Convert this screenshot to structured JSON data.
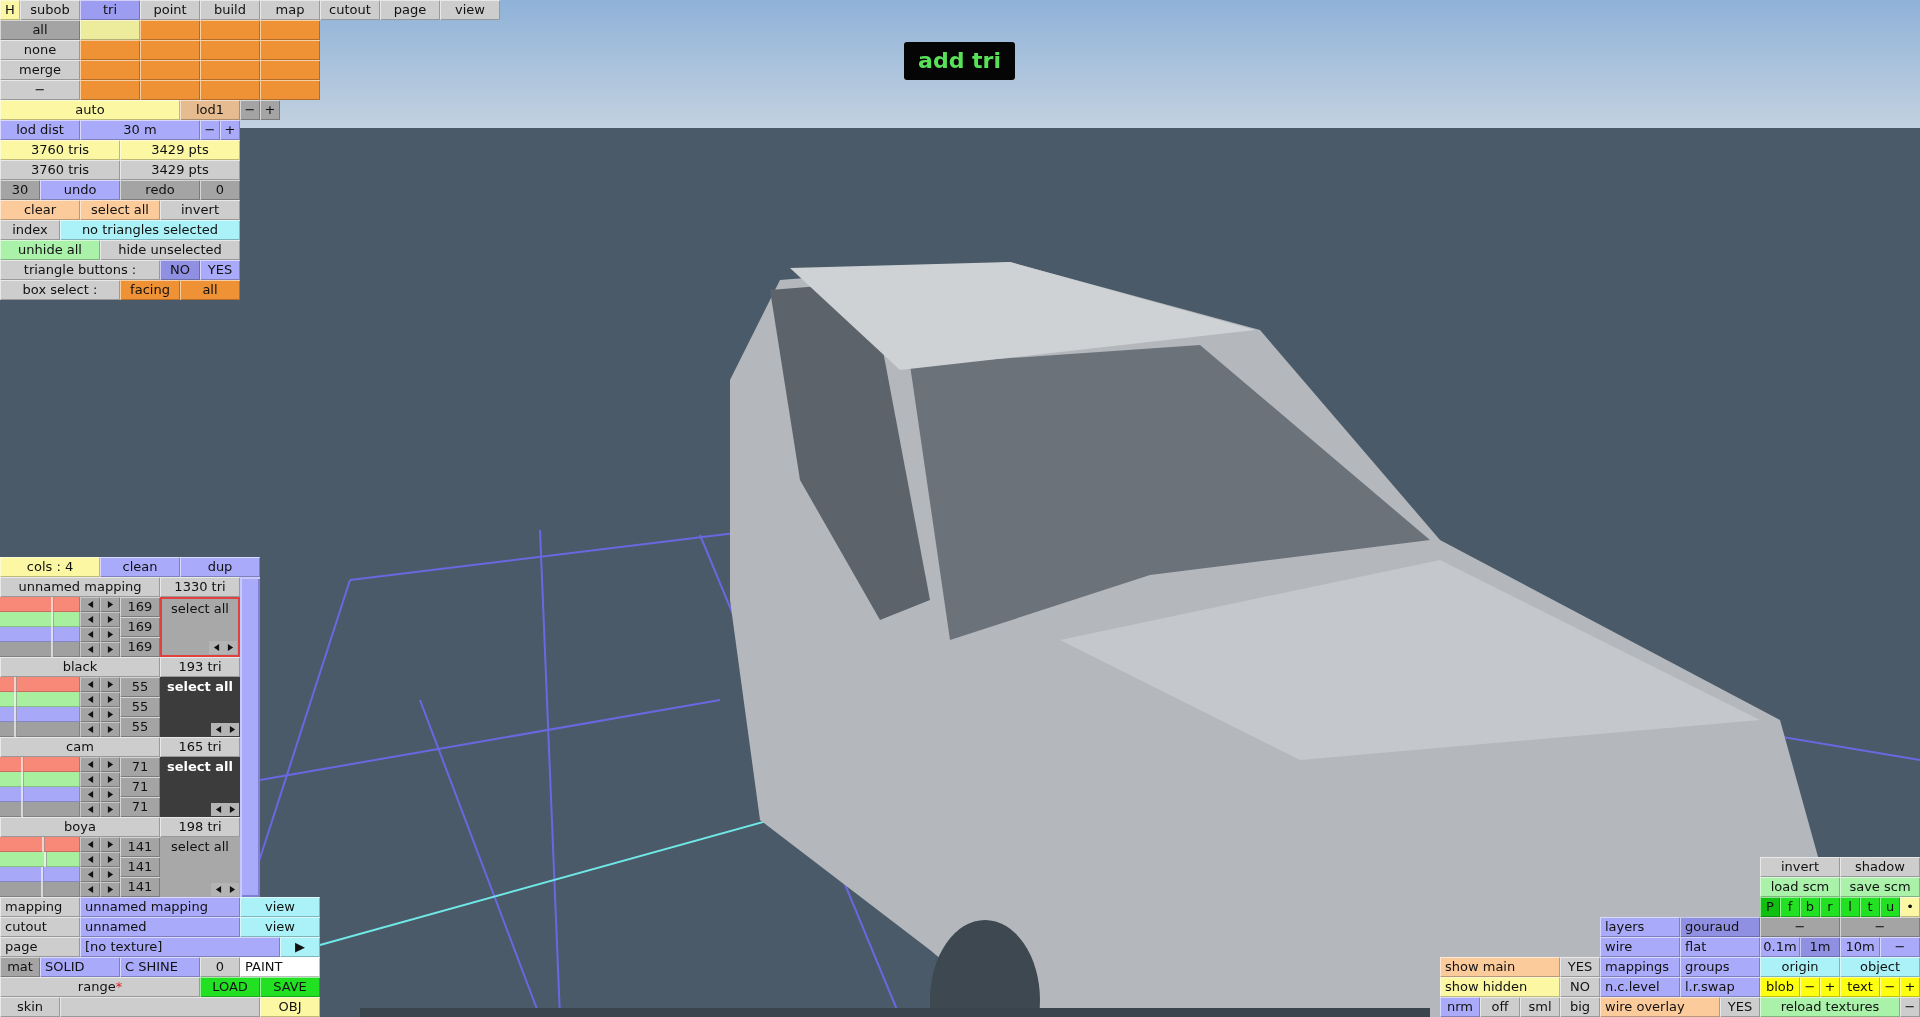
{
  "menu": {
    "help": {
      "label": "H"
    },
    "tabs": [
      {
        "label": "subob",
        "selected": false
      },
      {
        "label": "tri",
        "selected": true
      },
      {
        "label": "point",
        "selected": false
      },
      {
        "label": "build",
        "selected": false
      },
      {
        "label": "map",
        "selected": false
      },
      {
        "label": "cutout",
        "selected": false
      },
      {
        "label": "page",
        "selected": false
      },
      {
        "label": "view",
        "selected": false
      }
    ]
  },
  "status_message": "add tri",
  "top_panel": {
    "rows": [
      {
        "buttons": [
          {
            "text": "all",
            "color": "#a4a4a4",
            "kind": "button"
          },
          {
            "color": "#ecec9c",
            "kind": "swatch"
          },
          {
            "color": "#ef9236",
            "kind": "swatch"
          },
          {
            "color": "#ef9236",
            "kind": "swatch"
          },
          {
            "color": "#ef9236",
            "kind": "swatch"
          }
        ]
      },
      {
        "buttons": [
          {
            "text": "none",
            "color": "#cdcdcd",
            "kind": "button"
          },
          {
            "color": "#ef9236",
            "kind": "swatch"
          },
          {
            "color": "#ef9236",
            "kind": "swatch"
          },
          {
            "color": "#ef9236",
            "kind": "swatch"
          },
          {
            "color": "#ef9236",
            "kind": "swatch"
          }
        ]
      },
      {
        "buttons": [
          {
            "text": "merge",
            "color": "#cdcdcd",
            "kind": "button"
          },
          {
            "color": "#ef9236",
            "kind": "swatch"
          },
          {
            "color": "#ef9236",
            "kind": "swatch"
          },
          {
            "color": "#ef9236",
            "kind": "swatch"
          },
          {
            "color": "#ef9236",
            "kind": "swatch"
          }
        ]
      },
      {
        "buttons": [
          {
            "text": "−",
            "color": "#cdcdcd",
            "kind": "button"
          },
          {
            "color": "#ef9236",
            "kind": "swatch"
          },
          {
            "color": "#ef9236",
            "kind": "swatch"
          },
          {
            "color": "#ef9236",
            "kind": "swatch"
          },
          {
            "color": "#ef9236",
            "kind": "swatch"
          }
        ]
      },
      {
        "buttons": [
          {
            "text": "auto",
            "color": "#fbf7a2",
            "kind": "button"
          },
          {
            "text": "lod1",
            "color": "#e6bb8f",
            "kind": "button"
          },
          {
            "text": "−",
            "color": "#a4a4a4",
            "kind": "button"
          },
          {
            "text": "+",
            "color": "#a4a4a4",
            "kind": "button"
          }
        ]
      },
      {
        "buttons": [
          {
            "text": "lod dist",
            "color": "#aaaafa",
            "kind": "button"
          },
          {
            "text": "30 m",
            "color": "#aaaafa",
            "kind": "button"
          },
          {
            "text": "−",
            "color": "#aaaafa",
            "kind": "button"
          },
          {
            "text": "+",
            "color": "#aaaafa",
            "kind": "button"
          }
        ]
      },
      {
        "buttons": [
          {
            "text": "3760 tris",
            "color": "#fbf7a2",
            "kind": "button"
          },
          {
            "text": "3429 pts",
            "color": "#fbf7a2",
            "kind": "button"
          }
        ]
      },
      {
        "buttons": [
          {
            "text": "3760 tris",
            "color": "#cdcdcd",
            "kind": "button"
          },
          {
            "text": "3429 pts",
            "color": "#cdcdcd",
            "kind": "button"
          }
        ]
      },
      {
        "buttons": [
          {
            "text": "30",
            "color": "#a4a4a4",
            "kind": "button"
          },
          {
            "text": "undo",
            "color": "#aaaafa",
            "kind": "button"
          },
          {
            "text": "redo",
            "color": "#a4a4a4",
            "kind": "button"
          },
          {
            "text": "0",
            "color": "#a4a4a4",
            "kind": "button"
          }
        ]
      },
      {
        "buttons": [
          {
            "text": "clear",
            "color": "#fbcb9b",
            "kind": "button"
          },
          {
            "text": "select all",
            "color": "#fbcb9b",
            "kind": "button"
          },
          {
            "text": "invert",
            "color": "#cdcdcd",
            "kind": "button"
          }
        ]
      },
      {
        "buttons": [
          {
            "text": "index",
            "color": "#cdcdcd",
            "kind": "button"
          },
          {
            "text": "no triangles selected",
            "color": "#aaf2f8",
            "kind": "button"
          }
        ]
      },
      {
        "buttons": [
          {
            "text": "unhide all",
            "color": "#aaf2aa",
            "kind": "button"
          },
          {
            "text": "hide unselected",
            "color": "#cdcdcd",
            "kind": "button"
          }
        ]
      },
      {
        "buttons": [
          {
            "text": "triangle buttons :",
            "color": "#cdcdcd",
            "kind": "button"
          },
          {
            "text": "NO",
            "color": "#9090e2",
            "kind": "button"
          },
          {
            "text": "YES",
            "color": "#aaaafa",
            "kind": "button"
          }
        ]
      },
      {
        "buttons": [
          {
            "text": "box select :",
            "color": "#cdcdcd",
            "kind": "button"
          },
          {
            "text": "facing",
            "color": "#ef9236",
            "kind": "button"
          },
          {
            "text": "all",
            "color": "#ef9236",
            "kind": "button"
          }
        ]
      }
    ]
  },
  "mappings_panel": {
    "header": {
      "buttons": [
        {
          "text": "cols : 4",
          "color": "#fbf7a2",
          "kind": "button"
        },
        {
          "text": "clean",
          "color": "#aaaafa",
          "kind": "button"
        },
        {
          "text": "dup",
          "color": "#aaaafa",
          "kind": "button"
        }
      ]
    },
    "mappings": [
      {
        "name": "unnamed mapping",
        "count": "1330 tri",
        "values": [
          "169",
          "169",
          "169"
        ],
        "select_button": {
          "label": "select all",
          "color": "#a8a8a8"
        },
        "selected": true,
        "sliders": [
          {
            "color": "#f88878",
            "level": 0.65
          },
          {
            "color": "#a8f0a0",
            "level": 0.65
          },
          {
            "color": "#a8a8f8",
            "level": 0.65
          },
          {
            "color": "#a0a0a0",
            "level": 0.65
          }
        ]
      },
      {
        "name": "black",
        "count": "193 tri",
        "values": [
          "55",
          "55",
          "55"
        ],
        "select_button": {
          "label": "select all",
          "color": "#3c3c3c"
        },
        "selected": false,
        "sliders": [
          {
            "color": "#f88878",
            "level": 0.19
          },
          {
            "color": "#a8f0a0",
            "level": 0.19
          },
          {
            "color": "#a8a8f8",
            "level": 0.19
          },
          {
            "color": "#a0a0a0",
            "level": 0.19
          }
        ]
      },
      {
        "name": "cam",
        "count": "165 tri",
        "values": [
          "71",
          "71",
          "71"
        ],
        "select_button": {
          "label": "select all",
          "color": "#3c3c3c"
        },
        "selected": false,
        "sliders": [
          {
            "color": "#f88878",
            "level": 0.27
          },
          {
            "color": "#a8f0a0",
            "level": 0.27
          },
          {
            "color": "#a8a8f8",
            "level": 0.27
          },
          {
            "color": "#a0a0a0",
            "level": 0.27
          }
        ]
      },
      {
        "name": "boya",
        "count": "198 tri",
        "values": [
          "141",
          "141",
          "141"
        ],
        "select_button": {
          "label": "select all",
          "color": "#a8a8a8"
        },
        "selected": false,
        "sliders": [
          {
            "color": "#f88878",
            "level": 0.54
          },
          {
            "color": "#a8f0a0",
            "level": 0.56
          },
          {
            "color": "#a8a8f8",
            "level": 0.52
          },
          {
            "color": "#a0a0a0",
            "level": 0.53
          }
        ]
      }
    ],
    "rows": [
      {
        "buttons": [
          {
            "text": "mapping",
            "color": "#cdcdcd",
            "kind": "label"
          },
          {
            "text": "unnamed mapping",
            "color": "#aaaafa",
            "kind": "label"
          },
          {
            "text": "view",
            "color": "#aaf2f8",
            "kind": "button"
          }
        ]
      },
      {
        "buttons": [
          {
            "text": "cutout",
            "color": "#cdcdcd",
            "kind": "label"
          },
          {
            "text": "unnamed",
            "color": "#aaaafa",
            "kind": "label"
          },
          {
            "text": "view",
            "color": "#aaf2f8",
            "kind": "button"
          }
        ]
      },
      {
        "buttons": [
          {
            "text": "page",
            "color": "#cdcdcd",
            "kind": "label"
          },
          {
            "text": "[no texture]",
            "color": "#aaaafa",
            "kind": "label"
          },
          {
            "text": "▶",
            "color": "#aaf2f8",
            "kind": "button"
          }
        ]
      },
      {
        "buttons": [
          {
            "text": "mat",
            "color": "#a4a4a4",
            "kind": "button"
          },
          {
            "text": "SOLID",
            "color": "#aaaafa",
            "kind": "label"
          },
          {
            "text": "C SHINE",
            "color": "#aaaafa",
            "kind": "label"
          },
          {
            "text": "0",
            "color": "#cdcdcd",
            "kind": "button"
          },
          {
            "text": "PAINT",
            "color": "#ffffff",
            "kind": "label"
          }
        ]
      },
      {
        "buttons": [
          {
            "text": "range",
            "mark": "*",
            "color": "#cdcdcd",
            "kind": "button"
          },
          {
            "text": "LOAD",
            "color": "#22e022",
            "kind": "button"
          },
          {
            "text": "SAVE",
            "color": "#22e022",
            "kind": "button"
          }
        ]
      },
      {
        "buttons": [
          {
            "text": "skin",
            "color": "#cdcdcd",
            "kind": "button"
          },
          {
            "color": "#cdcdcd",
            "kind": "field"
          },
          {
            "text": "OBJ",
            "color": "#fbf7a2",
            "kind": "button"
          }
        ]
      }
    ]
  },
  "view_panel": {
    "clusters": [
      {
        "rows": [
          {
            "buttons": [
              {
                "text": "show main",
                "color": "#fbcb9b",
                "kind": "label"
              },
              {
                "text": "YES",
                "color": "#cdcdcd",
                "kind": "button"
              }
            ]
          },
          {
            "buttons": [
              {
                "text": "show hidden",
                "color": "#fbf7a2",
                "kind": "label"
              },
              {
                "text": "NO",
                "color": "#cdcdcd",
                "kind": "button"
              }
            ]
          },
          {
            "buttons": [
              {
                "text": "nrm",
                "color": "#aaaafa",
                "kind": "button"
              },
              {
                "text": "off",
                "color": "#cdcdcd",
                "kind": "button"
              },
              {
                "text": "sml",
                "color": "#cdcdcd",
                "kind": "button"
              },
              {
                "text": "big",
                "color": "#cdcdcd",
                "kind": "button"
              }
            ]
          }
        ]
      },
      {
        "rows": [
          {
            "buttons": [
              {
                "text": "layers",
                "color": "#aaaafa",
                "kind": "label"
              },
              {
                "text": "gouraud",
                "color": "#9090e2",
                "kind": "label"
              }
            ]
          },
          {
            "buttons": [
              {
                "text": "wire",
                "color": "#aaaafa",
                "kind": "label"
              },
              {
                "text": "flat",
                "color": "#aaaafa",
                "kind": "label"
              }
            ]
          },
          {
            "buttons": [
              {
                "text": "mappings",
                "color": "#aaaafa",
                "kind": "label"
              },
              {
                "text": "groups",
                "color": "#aaaafa",
                "kind": "label"
              }
            ]
          },
          {
            "buttons": [
              {
                "text": "n.c.level",
                "color": "#aaaafa",
                "kind": "label"
              },
              {
                "text": "l.r.swap",
                "color": "#aaaafa",
                "kind": "label"
              }
            ]
          },
          {
            "buttons": [
              {
                "text": "wire overlay",
                "color": "#fbcb9b",
                "kind": "label"
              },
              {
                "text": "YES",
                "color": "#cdcdcd",
                "kind": "button"
              }
            ]
          }
        ]
      },
      {
        "rows": [
          {
            "buttons": [
              {
                "text": "invert",
                "color": "#cdcdcd",
                "kind": "button"
              },
              {
                "text": "shadow",
                "color": "#cdcdcd",
                "kind": "button"
              }
            ]
          },
          {
            "buttons": [
              {
                "text": "load scm",
                "color": "#aaf2aa",
                "kind": "button"
              },
              {
                "text": "save scm",
                "color": "#aaf2aa",
                "kind": "button"
              }
            ]
          },
          {
            "buttons": [
              {
                "text": "P",
                "color": "#10c010",
                "kind": "button"
              },
              {
                "text": "f",
                "color": "#22e022",
                "kind": "button"
              },
              {
                "text": "b",
                "color": "#22e022",
                "kind": "button"
              },
              {
                "text": "r",
                "color": "#22e022",
                "kind": "button"
              },
              {
                "text": "l",
                "color": "#22e022",
                "kind": "button"
              },
              {
                "text": "t",
                "color": "#22e022",
                "kind": "button"
              },
              {
                "text": "u",
                "color": "#22e022",
                "kind": "button"
              },
              {
                "text": "•",
                "color": "#fbf7a2",
                "kind": "button"
              }
            ]
          },
          {
            "buttons": [
              {
                "text": "−",
                "color": "#a4a4a4",
                "kind": "button"
              },
              {
                "text": "−",
                "color": "#a4a4a4",
                "kind": "button"
              }
            ]
          },
          {
            "buttons": [
              {
                "text": "0.1m",
                "color": "#aaaafa",
                "kind": "button"
              },
              {
                "text": "1m",
                "color": "#9090e2",
                "kind": "button"
              },
              {
                "text": "10m",
                "color": "#aaaafa",
                "kind": "button"
              },
              {
                "text": "−",
                "color": "#aaaafa",
                "kind": "button"
              }
            ]
          },
          {
            "buttons": [
              {
                "text": "origin",
                "color": "#aaf2f8",
                "kind": "button"
              },
              {
                "text": "object",
                "color": "#aaf2f8",
                "kind": "button"
              }
            ]
          },
          {
            "buttons": [
              {
                "text": "blob",
                "color": "#ffff10",
                "kind": "button"
              },
              {
                "text": "−",
                "color": "#ffff10",
                "kind": "button"
              },
              {
                "text": "+",
                "color": "#ffff10",
                "kind": "button"
              },
              {
                "text": "text",
                "color": "#ffff10",
                "kind": "button"
              },
              {
                "text": "−",
                "color": "#ffff10",
                "kind": "button"
              },
              {
                "text": "+",
                "color": "#ffff10",
                "kind": "button"
              }
            ]
          },
          {
            "buttons": [
              {
                "text": "reload textures",
                "color": "#aaf2aa",
                "kind": "button"
              },
              {
                "text": "−",
                "color": "#cdcdcd",
                "kind": "button"
              }
            ]
          }
        ]
      }
    ]
  }
}
